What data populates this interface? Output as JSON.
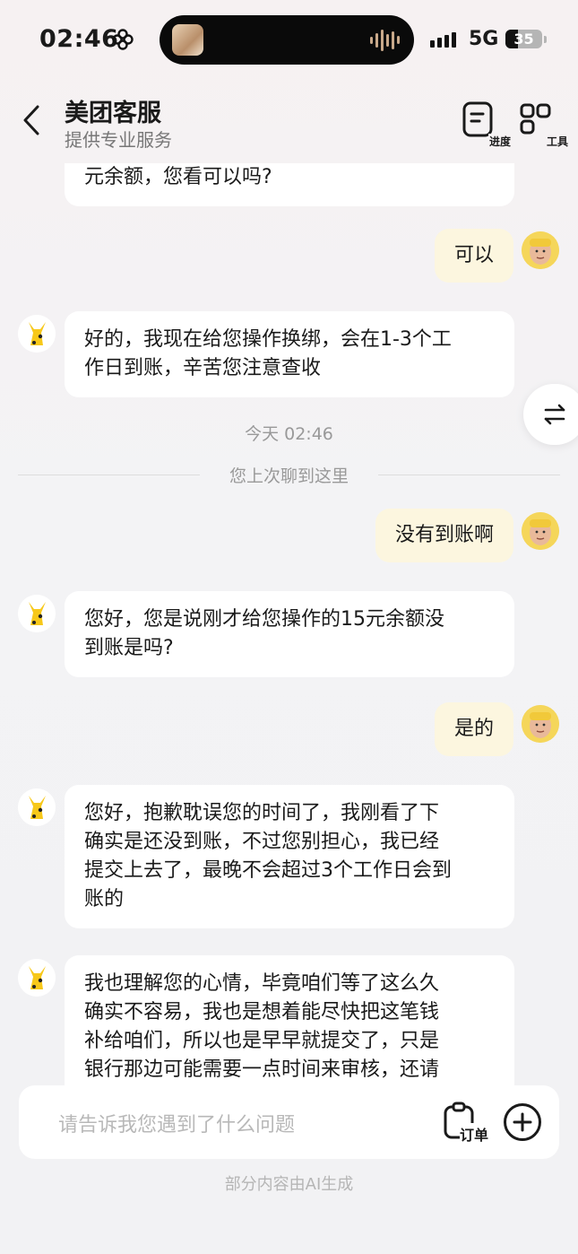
{
  "status_bar": {
    "time": "02:46",
    "network": "5G",
    "battery": "35",
    "battery_level": 0.35
  },
  "header": {
    "title": "美团客服",
    "subtitle": "提供专业服务",
    "progress_label": "进度",
    "tools_label": "工具"
  },
  "messages": [
    {
      "role": "bot",
      "lines": [
        "元余额，您看可以吗?"
      ]
    },
    {
      "role": "user",
      "text": "可以"
    },
    {
      "role": "bot",
      "lines": [
        "好的，我现在给您操作换绑，会在1-3个工",
        "作日到账，辛苦您注意查收"
      ]
    },
    {
      "role": "user",
      "text": "没有到账啊"
    },
    {
      "role": "bot",
      "lines": [
        "您好，您是说刚才给您操作的15元余额没",
        "到账是吗?"
      ]
    },
    {
      "role": "user",
      "text": "是的"
    },
    {
      "role": "bot",
      "lines": [
        "您好，抱歉耽误您的时间了，我刚看了下",
        "确实是还没到账，不过您别担心，我已经",
        "提交上去了，最晚不会超过3个工作日会到",
        "账的"
      ]
    },
    {
      "role": "bot",
      "lines": [
        "我也理解您的心情，毕竟咱们等了这么久",
        "确实不容易，我也是想着能尽快把这笔钱",
        "补给咱们，所以也是早早就提交了，只是",
        "银行那边可能需要一点时间来审核，还请"
      ]
    }
  ],
  "divider": {
    "time": "今天 02:46",
    "text": "您上次聊到这里"
  },
  "input": {
    "placeholder": "请告诉我您遇到了什么问题",
    "order_label": "订单"
  },
  "footer_note": "部分内容由AI生成"
}
